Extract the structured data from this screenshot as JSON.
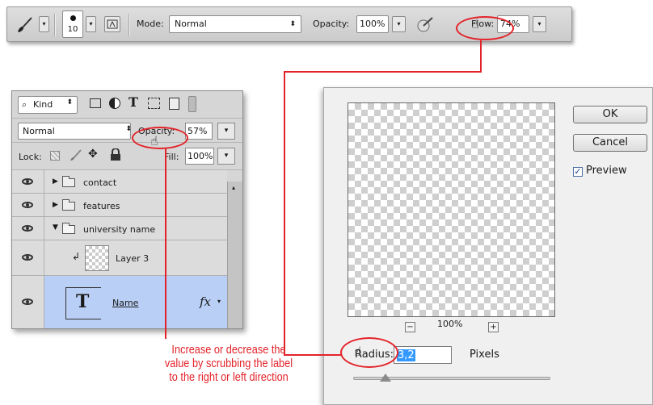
{
  "toolbar": {
    "brush_size": "10",
    "mode_label": "Mode:",
    "mode_value": "Normal",
    "opacity_label": "Opacity:",
    "opacity_value": "100%",
    "flow_label": "Flow:",
    "flow_value": "74%"
  },
  "layers_panel": {
    "filter_kind": "Kind",
    "blend_mode": "Normal",
    "opacity_label": "Opacity:",
    "opacity_value": "57%",
    "lock_label": "Lock:",
    "fill_label": "Fill:",
    "fill_value": "100%",
    "layers": [
      {
        "name": "contact",
        "type": "group"
      },
      {
        "name": "features",
        "type": "group"
      },
      {
        "name": "university name",
        "type": "group-open"
      },
      {
        "name": "Layer 3",
        "type": "layer"
      },
      {
        "name": "Name",
        "type": "text",
        "selected": true
      }
    ],
    "type_thumb_glyph": "T",
    "fx_label": "fx"
  },
  "dialog": {
    "ok_label": "OK",
    "cancel_label": "Cancel",
    "preview_label": "Preview",
    "preview_checked": true,
    "zoom_value": "100%",
    "zoom_out_glyph": "−",
    "zoom_in_glyph": "+",
    "radius_label": "Radius:",
    "radius_value": "3,2",
    "radius_unit": "Pixels"
  },
  "annotation": {
    "line1": "Increase or decrease the",
    "line2": "value by scrubbing the label",
    "line3": "to the right or left direction"
  },
  "colors": {
    "annotation_red": "#e3232a",
    "selected_layer": "#b9cff5"
  }
}
